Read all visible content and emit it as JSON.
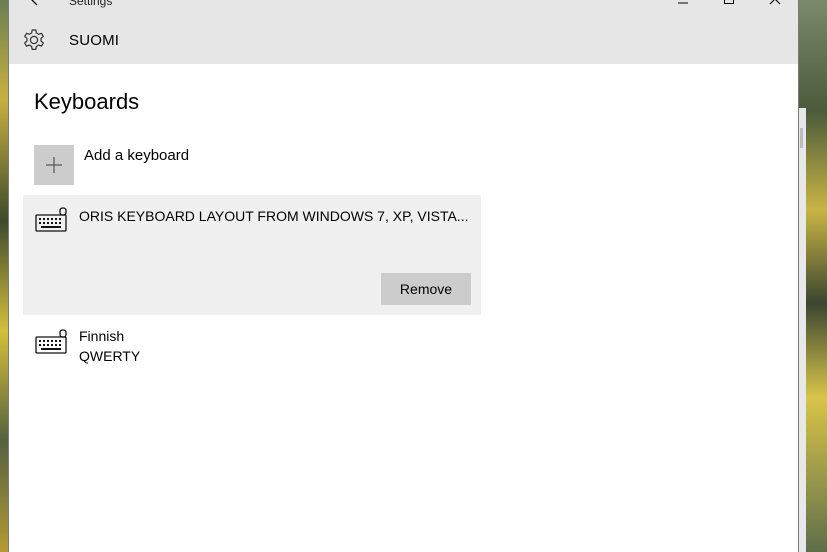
{
  "window": {
    "title": "Settings",
    "page_header": "SUOMI"
  },
  "main": {
    "heading": "Keyboards",
    "add_keyboard_label": "Add a keyboard",
    "keyboards": [
      {
        "name": "ORIS KEYBOARD LAYOUT FROM WINDOWS 7, XP, VISTA...",
        "subtitle": "",
        "selected": true,
        "remove_label": "Remove"
      },
      {
        "name": "Finnish",
        "subtitle": "QWERTY",
        "selected": false
      }
    ]
  },
  "icons": {
    "back": "back-arrow-icon",
    "minimize": "minimize-icon",
    "maximize": "maximize-icon",
    "close": "close-icon",
    "settings": "gear-icon",
    "add": "plus-icon",
    "keyboard": "keyboard-icon"
  },
  "colors": {
    "titlebar": "#e6e6e6",
    "selected_item": "#f0f0f0",
    "button": "#cccccc"
  }
}
